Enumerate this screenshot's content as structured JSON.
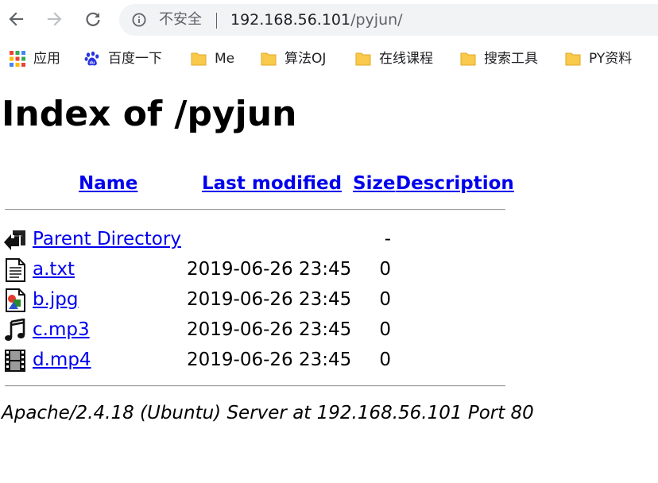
{
  "browser": {
    "security_text": "不安全",
    "url_host": "192.168.56.101",
    "url_path": "/pyjun/",
    "bookmarks": [
      {
        "label": "应用",
        "icon": "apps-grid-icon"
      },
      {
        "label": "百度一下",
        "icon": "baidu-paw-icon"
      },
      {
        "label": "Me",
        "icon": "folder-icon"
      },
      {
        "label": "算法OJ",
        "icon": "folder-icon"
      },
      {
        "label": "在线课程",
        "icon": "folder-icon"
      },
      {
        "label": "搜索工具",
        "icon": "folder-icon"
      },
      {
        "label": "PY资料",
        "icon": "folder-icon"
      }
    ]
  },
  "page": {
    "title": "Index of /pyjun",
    "columns": {
      "name": "Name",
      "last_modified": "Last modified",
      "size": "Size",
      "description": "Description"
    },
    "rows": [
      {
        "name": "Parent Directory",
        "date": "",
        "size": "-",
        "icon": "back-arrow-icon"
      },
      {
        "name": "a.txt",
        "date": "2019-06-26 23:45",
        "size": "0",
        "icon": "text-file-icon"
      },
      {
        "name": "b.jpg",
        "date": "2019-06-26 23:45",
        "size": "0",
        "icon": "image-file-icon"
      },
      {
        "name": "c.mp3",
        "date": "2019-06-26 23:45",
        "size": "0",
        "icon": "sound-file-icon"
      },
      {
        "name": "d.mp4",
        "date": "2019-06-26 23:45",
        "size": "0",
        "icon": "movie-file-icon"
      }
    ],
    "address": "Apache/2.4.18 (Ubuntu) Server at 192.168.56.101 Port 80"
  }
}
